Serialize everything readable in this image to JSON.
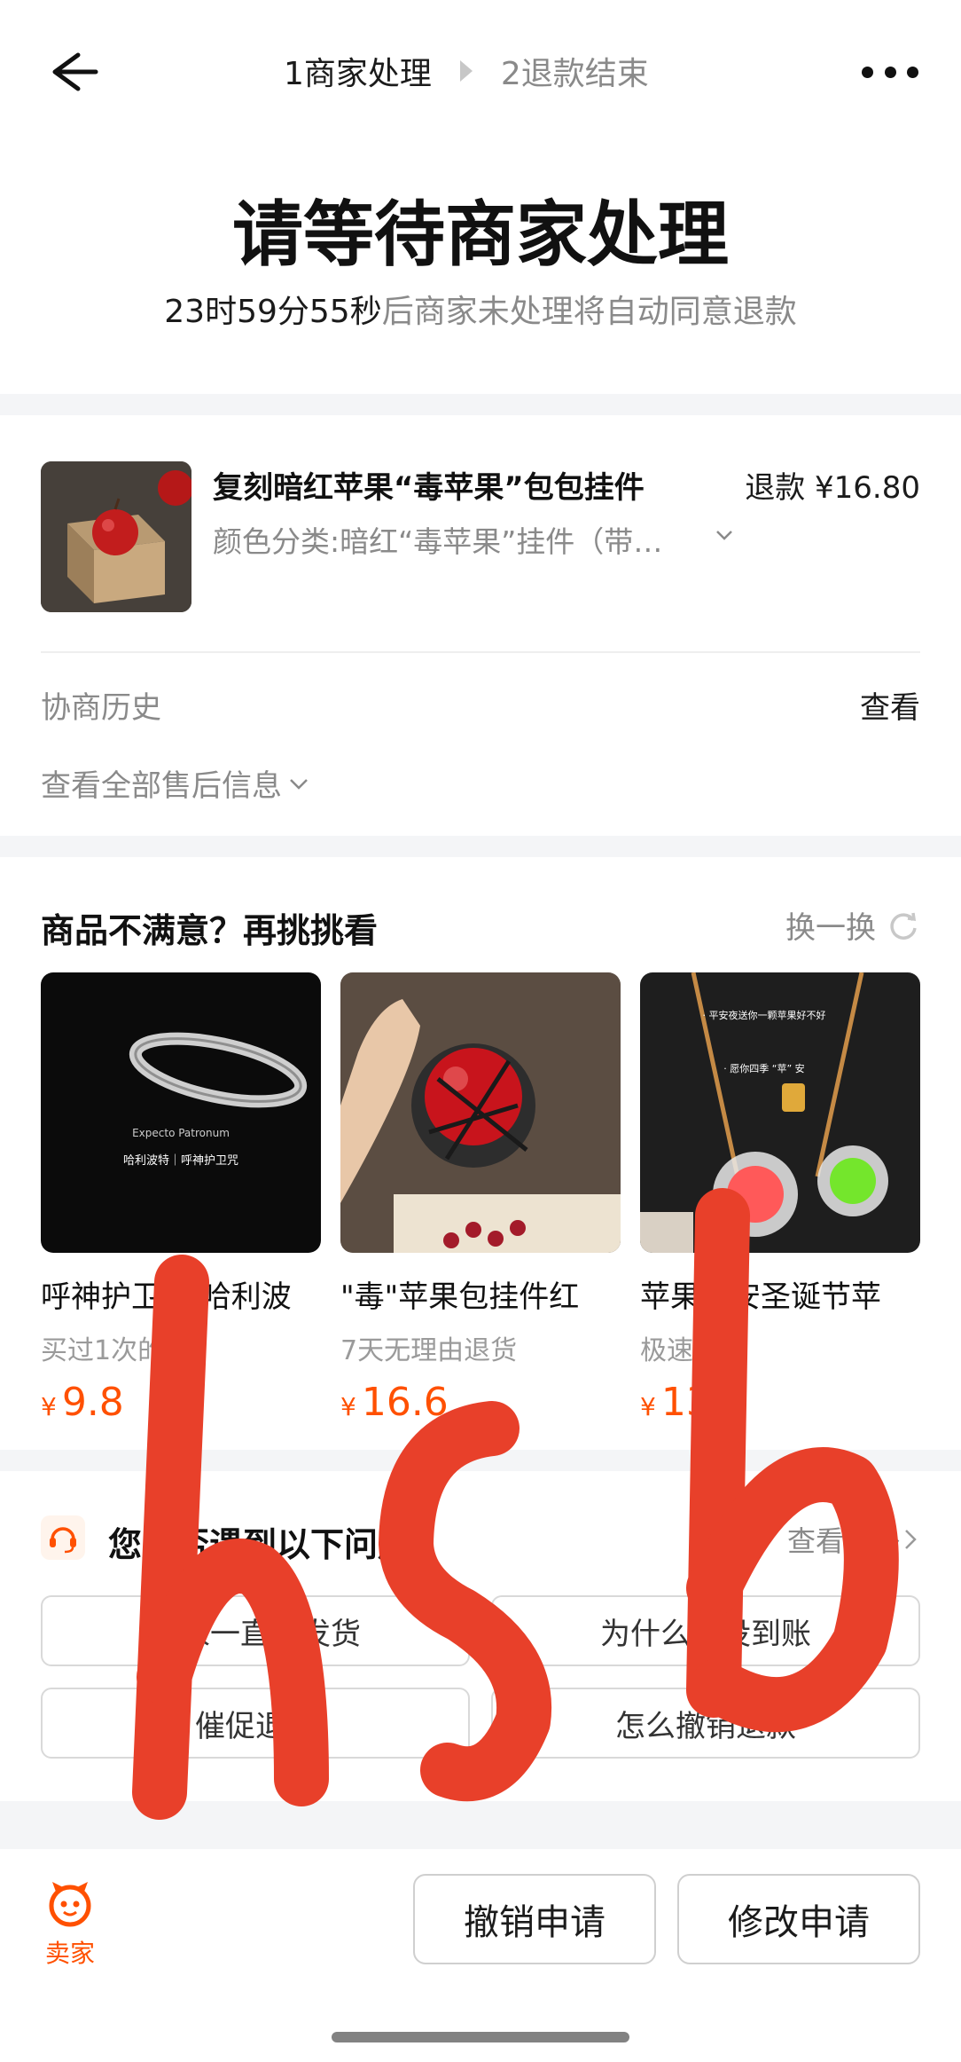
{
  "header": {
    "step1": "1商家处理",
    "step2": "2退款结束"
  },
  "status": {
    "title": "请等待商家处理",
    "countdown": "23时59分55秒",
    "countdown_suffix": "后商家未处理将自动同意退款"
  },
  "order": {
    "product_name": "复刻暗红苹果“毒苹果”包包挂件",
    "refund": "退款 ¥16.80",
    "sku": "颜色分类:暗红“毒苹果”挂件（带包装盒）",
    "history_label": "协商历史",
    "history_action": "查看",
    "all_info": "查看全部售后信息"
  },
  "recommend": {
    "title": "商品不满意？再挑挑看",
    "swap": "换一换",
    "items": [
      {
        "title": "呼神护卫咒 哈利波",
        "sub": "买过1次的店",
        "price": "9.8",
        "img_line1": "Expecto Patronum",
        "img_line2": "哈利波特｜呼神护卫咒"
      },
      {
        "title": "\"毒\"苹果包挂件红",
        "sub": "7天无理由退货",
        "price": "16.6"
      },
      {
        "title": "苹果平安圣诞节苹",
        "sub": "极速退款",
        "price": "13",
        "img_line1": "· 平安夜送你一颗苹果好不好",
        "img_line2": "· 愿你四季 “苹” 安"
      }
    ]
  },
  "help": {
    "title": "您是否遇到以下问题？",
    "more": "查看更多",
    "questions": [
      "卖家一直不发货",
      "为什么还没到账",
      "催促退款",
      "怎么撤销退款"
    ]
  },
  "footer": {
    "seller_label": "卖家",
    "cancel_btn": "撤销申请",
    "modify_btn": "修改申请"
  },
  "handwriting": "hsb",
  "colors": {
    "accent": "#ff5000",
    "ink": "#e8402a"
  }
}
